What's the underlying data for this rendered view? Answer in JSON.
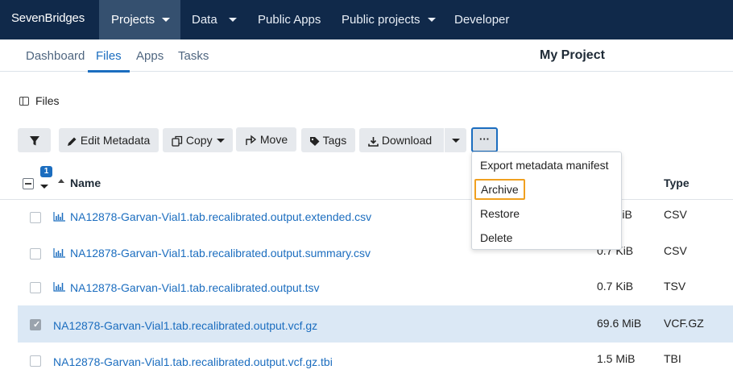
{
  "brand": "SevenBridges",
  "topnav": [
    {
      "label": "Projects",
      "caret": true,
      "active": true
    },
    {
      "label": "Data",
      "caret": true
    },
    {
      "label": "Public Apps",
      "caret": false
    },
    {
      "label": "Public projects",
      "caret": true
    },
    {
      "label": "Developer",
      "caret": false
    }
  ],
  "subnav": {
    "items": [
      "Dashboard",
      "Files",
      "Apps",
      "Tasks"
    ],
    "active": "Files",
    "project_title": "My Project"
  },
  "files_header": "Files",
  "toolbar": {
    "edit_metadata": "Edit Metadata",
    "copy": "Copy",
    "move": "Move",
    "tags": "Tags",
    "download": "Download",
    "more": "···"
  },
  "table": {
    "selected_count": "1",
    "name_header": "Name",
    "type_header": "Type",
    "rows": [
      {
        "name": "NA12878-Garvan-Vial1.tab.recalibrated.output.extended.csv",
        "size": "KiB",
        "type": "CSV",
        "chart_icon": true,
        "selected": false
      },
      {
        "name": "NA12878-Garvan-Vial1.tab.recalibrated.output.summary.csv",
        "size": "0.7 KiB",
        "type": "CSV",
        "chart_icon": true,
        "selected": false
      },
      {
        "name": "NA12878-Garvan-Vial1.tab.recalibrated.output.tsv",
        "size": "0.7 KiB",
        "type": "TSV",
        "chart_icon": true,
        "selected": false
      },
      {
        "name": "NA12878-Garvan-Vial1.tab.recalibrated.output.vcf.gz",
        "size": "69.6 MiB",
        "type": "VCF.GZ",
        "chart_icon": false,
        "selected": true
      },
      {
        "name": "NA12878-Garvan-Vial1.tab.recalibrated.output.vcf.gz.tbi",
        "size": "1.5 MiB",
        "type": "TBI",
        "chart_icon": false,
        "selected": false
      }
    ]
  },
  "more_menu": {
    "items": [
      "Export metadata manifest",
      "Archive",
      "Restore",
      "Delete"
    ],
    "highlighted": "Archive"
  },
  "colors": {
    "topnav_bg": "#10294a",
    "active_nav_bg": "#35506f",
    "link": "#1b6dbf",
    "highlight_border": "#f0a020",
    "selected_row": "#dbe8f5"
  }
}
